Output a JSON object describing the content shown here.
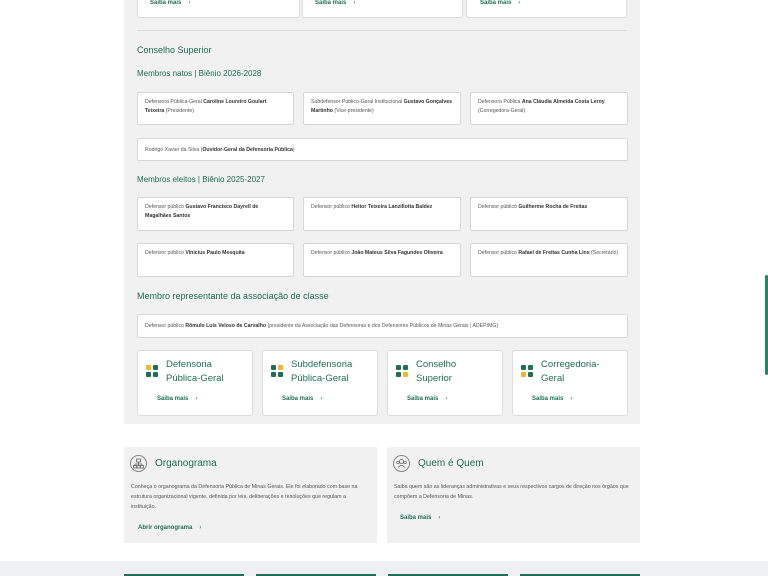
{
  "top_cards": [
    {
      "saiba_label": "Saiba mais",
      "chevron": "›"
    },
    {
      "saiba_label": "Saiba mais",
      "chevron": "›"
    },
    {
      "saiba_label": "Saiba mais",
      "chevron": "›"
    }
  ],
  "conselho": {
    "title": "Conselho Superior",
    "natos_heading": "Membros natos | Biênio 2026-2028",
    "natos": [
      {
        "pre": "Defensora Pública-Geral ",
        "name": "Caroline Loureiro Goulart Teixeira",
        "post": " (Presidente)"
      },
      {
        "pre": "Subdefensor Público-Geral Institucional ",
        "name": "Gustavo Gonçalves Martinho",
        "post": " (Vice-presidente)"
      },
      {
        "pre": "Defensora Pública ",
        "name": "Ana Cláudia Almeida Costa Leroy",
        "post": "  (Corregedora-Geral)"
      }
    ],
    "ouvidor": {
      "pre": "Rodrigo Xavier da Silva (",
      "name": "Ouvidor-Geral da Defensoria Pública",
      "post": ")"
    },
    "eleitos_heading": "Membros eleitos | Biênio 2025-2027",
    "eleitos": [
      {
        "pre": "Defensor público ",
        "name": "Gustavo Francisco Dayrell de Magalhães Santos",
        "post": ""
      },
      {
        "pre": "Defensor público ",
        "name": "Heitor Teixeira Lanzillotta Baldez",
        "post": ""
      },
      {
        "pre": "Defensor público ",
        "name": "Guilherme Rocha de Freitas",
        "post": ""
      },
      {
        "pre": "Defensor público ",
        "name": "Vinícius Paulo Mesquita",
        "post": ""
      },
      {
        "pre": "Defensor público ",
        "name": "João Mateus Silva Fagundes Oliveira",
        "post": ""
      },
      {
        "pre": "Defensor público ",
        "name": "Rafael de Freitas Cunha Lins",
        "post": " (Secretário)"
      }
    ],
    "representante_heading": "Membro representante da associação de classe",
    "representante": {
      "pre": "Defensor público ",
      "name": "Rômulo Luis Veloso de Carvalho",
      "post": " (presidente da Associação das Defensoras e dos Defensores Públicos de Minas Gerais | ADEP/MG)"
    }
  },
  "org_cards": [
    {
      "title_line1": "Defensoria",
      "title_line2": "Pública-Geral",
      "saiba_label": "Saiba mais",
      "chevron": "›"
    },
    {
      "title_line1": "Subdefensoria",
      "title_line2": "Pública-Geral",
      "saiba_label": "Saiba mais",
      "chevron": "›"
    },
    {
      "title_line1": "Conselho",
      "title_line2": "Superior",
      "saiba_label": "Saiba mais",
      "chevron": "›"
    },
    {
      "title_line1": "Corregedoria-",
      "title_line2": "Geral",
      "saiba_label": "Saiba mais",
      "chevron": "›"
    }
  ],
  "organograma": {
    "title": "Organograma",
    "text": "Conheça o organograma da Defensoria Pública de Minas Gerais. Ele foi elaborado com base na estrutura organizacional vigente, definida por leis, deliberações e resoluções que regulam a instituição.",
    "link_label": "Abrir organograma",
    "chevron": "›"
  },
  "quem": {
    "title": "Quem é Quem",
    "text": "Saiba quem são as lideranças administrativas e seus respectivos cargos de direção nos órgãos que compõem a Defensoria de Minas.",
    "link_label": "Saiba mais",
    "chevron": "›"
  },
  "colors": {
    "accent": "#1f6e55",
    "icon_green": "#1f6e55",
    "icon_yellow": "#f2b431",
    "scrollbar": "#1f8a5e"
  }
}
